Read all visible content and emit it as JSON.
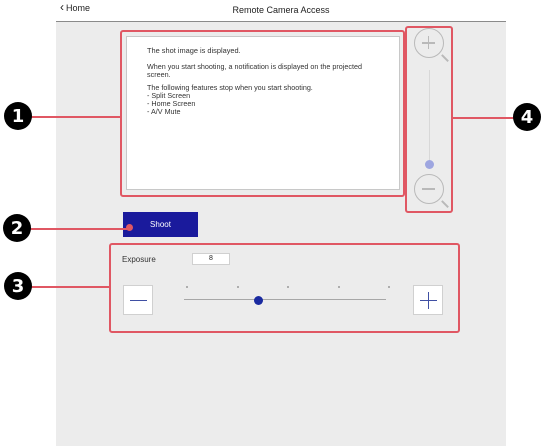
{
  "header": {
    "back_label": "Home",
    "title": "Remote Camera Access"
  },
  "preview": {
    "message": "The shot image is displayed.",
    "lines": [
      "When you start shooting, a notification is displayed on the projected screen.",
      "The following features stop when you start shooting.",
      "- Split Screen",
      "- Home Screen",
      "- A/V Mute"
    ]
  },
  "zoom": {
    "in_icon": "zoom-in-icon",
    "out_icon": "zoom-out-icon",
    "level": 0.1
  },
  "shoot": {
    "label": "Shoot"
  },
  "exposure": {
    "label": "Exposure",
    "value": "8",
    "minus_icon": "minus-icon",
    "plus_icon": "plus-icon",
    "slider_fraction": 0.375
  },
  "callouts": [
    "1",
    "2",
    "3",
    "4"
  ],
  "colors": {
    "accent": "#1a1a9c",
    "highlight": "#e05763"
  }
}
